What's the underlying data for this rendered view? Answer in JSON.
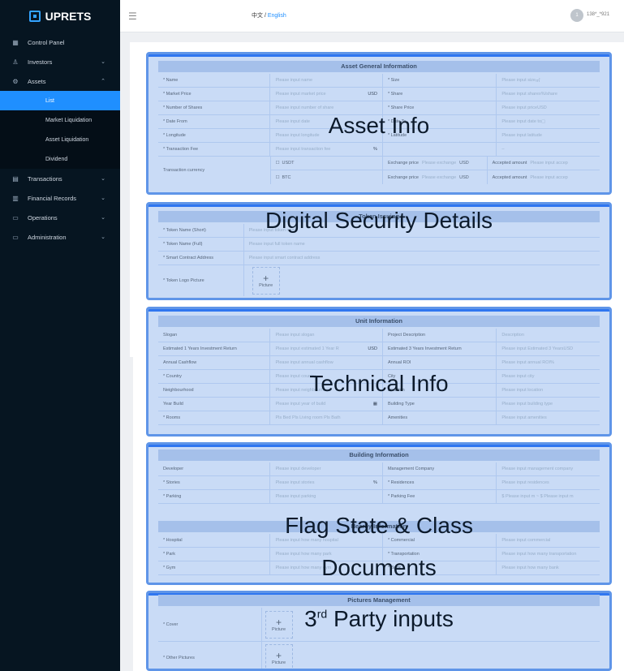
{
  "brand": {
    "name": "UPRETS"
  },
  "header": {
    "lang_zh": "中文 / ",
    "lang_en": "English",
    "avatar_text": "1",
    "user": "138*_*921"
  },
  "sidebar": {
    "items": [
      {
        "label": "Control Panel",
        "icon": "grid-icon",
        "glyph": "▦"
      },
      {
        "label": "Investors",
        "icon": "user-icon",
        "glyph": "♙"
      },
      {
        "label": "Assets",
        "icon": "gear-icon",
        "glyph": "⚙"
      },
      {
        "label": "Transactions",
        "icon": "list-icon",
        "glyph": "▤"
      },
      {
        "label": "Financial Records",
        "icon": "document-icon",
        "glyph": "▥"
      },
      {
        "label": "Operations",
        "icon": "window-icon",
        "glyph": "▭"
      },
      {
        "label": "Administration",
        "icon": "monitor-icon",
        "glyph": "▭"
      }
    ],
    "subitems": [
      "List",
      "Market Liquidation",
      "Asset Liquidation",
      "Dividend"
    ]
  },
  "sections": {
    "asset": {
      "title": "Asset General Information",
      "overlay": "Asset Info",
      "rows": [
        [
          "* Name",
          "Please input name",
          "",
          "* Size",
          "Please input size",
          "㎡"
        ],
        [
          "* Market Price",
          "Please input market price",
          "USD",
          "* Share",
          "Please input share",
          "x%/share"
        ],
        [
          "* Number of Shares",
          "Please input number of share",
          "",
          "* Share Price",
          "Please input price",
          "USD"
        ],
        [
          "* Date From",
          "Please input date",
          "",
          "* Date To",
          "Please input date to",
          "▢"
        ],
        [
          "* Longitude",
          "Please input longitude",
          "",
          "* Latitude",
          "Please input latitude",
          ""
        ],
        [
          "* Transaction Fee",
          "Please input transaction fee",
          "%",
          "",
          "–",
          ""
        ]
      ],
      "currency_label": "Transaction currency",
      "currency_rows": [
        [
          "USDT",
          "Exchange price",
          "Please exchange",
          "USD",
          "Accepted amount",
          "Please input accep"
        ],
        [
          "BTC",
          "Exchange price",
          "Please exchange",
          "USD",
          "Accepted amount",
          "Please input accep"
        ]
      ]
    },
    "token": {
      "title": "Token Issuing",
      "overlay": "Digital Security Details",
      "rows": [
        [
          "* Token Name (Short)",
          "Please input token name"
        ],
        [
          "* Token Name (Full)",
          "Please input full token name"
        ],
        [
          "* Smart Contract Address",
          "Please input smart contract address"
        ]
      ],
      "logo_label": "* Token Logo Picture",
      "picture_label": "Picture"
    },
    "unit": {
      "title": "Unit Information",
      "overlay": "Technical Info",
      "rows": [
        [
          "Slogan",
          "Please input slogan",
          "",
          "Project Description",
          "Description",
          ""
        ],
        [
          "Estimated 1 Years Investment Return",
          "Please input estimated 1 Year R",
          "USD",
          "Estimated 3 Years Investment Return",
          "Please input Estimated 3 Years",
          "USD"
        ],
        [
          "Annual Cashflow",
          "Please input annual cashflow",
          "",
          "Annual ROI",
          "Please input annual ROI",
          "%"
        ],
        [
          "* Country",
          "Please input country",
          "",
          "City",
          "Please input city",
          ""
        ],
        [
          "Neighbourhood",
          "Please input neighbourhood",
          "",
          "Location",
          "Please input location",
          ""
        ],
        [
          "Year Build",
          "Please input year of build",
          "▦",
          "Building Type",
          "Please input building type",
          ""
        ],
        [
          "* Rooms",
          "Pls  Bed  Pls  Living room  Pls  Bath",
          "",
          "Amenities",
          "Please input amenities",
          ""
        ]
      ]
    },
    "building": {
      "title": "Building Information",
      "overlay1": "Flag State & Class",
      "overlay2": "Documents",
      "subtitle": "Nearby Information",
      "rows": [
        [
          "Developer",
          "Please input developer",
          "",
          "Management Company",
          "Please input management company",
          ""
        ],
        [
          "* Stories",
          "Please input stories",
          "%",
          "* Residences",
          "Please input residences",
          ""
        ],
        [
          "* Parking",
          "Please input parking",
          "",
          "* Parking Fee",
          "$  Please input m  ~ $  Please input m",
          ""
        ]
      ],
      "nearby_rows": [
        [
          "* Hospital",
          "Please input how many hospital",
          "",
          "* Commercial",
          "Please input commercial",
          ""
        ],
        [
          "* Park",
          "Please input how many park",
          "",
          "* Transportation",
          "Please input how many transportation",
          ""
        ],
        [
          "* Gym",
          "Please input how many gym",
          "",
          "* Bank",
          "Please input how many bank",
          ""
        ]
      ]
    },
    "pictures": {
      "title": "Pictures Management",
      "overlay_pre": "3",
      "overlay_sup": "rd",
      "overlay_post": " Party inputs",
      "cover_label": "* Cover",
      "other_label": "* Other Pictures",
      "picture_label": "Picture"
    }
  }
}
